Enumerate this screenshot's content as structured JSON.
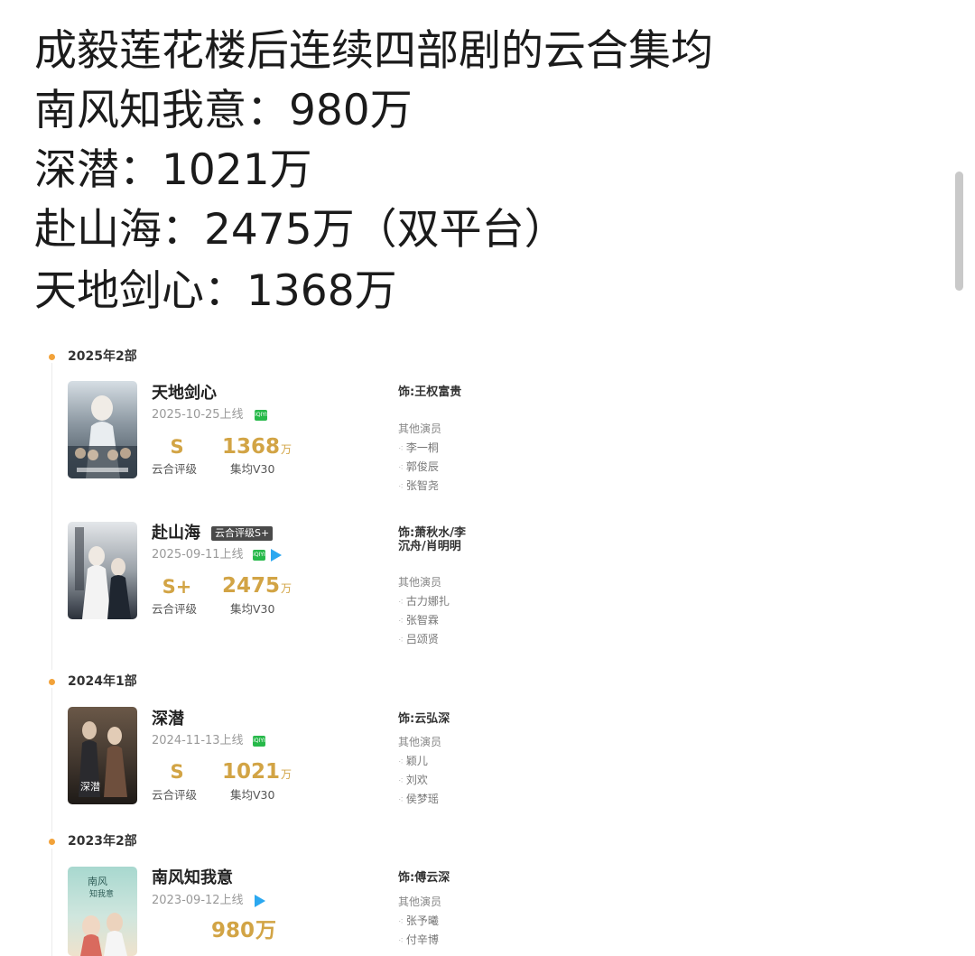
{
  "headline": {
    "line1": "成毅莲花楼后连续四部剧的云合集均",
    "line2": "南风知我意：980万",
    "line3": "深潜：1021万",
    "line4": "赴山海：2475万（双平台）",
    "line5": "天地剑心：1368万"
  },
  "timeline": {
    "years": [
      {
        "label": "2025年2部"
      },
      {
        "label": "2024年1部"
      },
      {
        "label": "2023年2部"
      }
    ],
    "shows": [
      {
        "title": "天地剑心",
        "date": "2025-10-25上线",
        "platforms": [
          "iqiyi-icon"
        ],
        "grade": "S",
        "grade_caption": "云合评级",
        "heat": "1368",
        "heat_unit": "万",
        "heat_caption": "集均V30",
        "role": "饰:王权富贵",
        "others_label": "其他演员",
        "cast": [
          "李一桐",
          "郭俊辰",
          "张智尧"
        ],
        "poster_colors": [
          "#c9d3da",
          "#52606c"
        ]
      },
      {
        "title": "赴山海",
        "badge": "云合评级S+",
        "date": "2025-09-11上线",
        "platforms": [
          "iqiyi-icon",
          "play-icon"
        ],
        "grade": "S+",
        "grade_caption": "云合评级",
        "heat": "2475",
        "heat_unit": "万",
        "heat_caption": "集均V30",
        "role": "饰:萧秋水/李沉舟/肖明明",
        "others_label": "其他演员",
        "cast": [
          "古力娜扎",
          "张智霖",
          "吕颂贤"
        ],
        "poster_colors": [
          "#d8dce0",
          "#2d3440"
        ]
      },
      {
        "title": "深潜",
        "date": "2024-11-13上线",
        "platforms": [
          "iqiyi-icon"
        ],
        "grade": "S",
        "grade_caption": "云合评级",
        "heat": "1021",
        "heat_unit": "万",
        "heat_caption": "集均V30",
        "role": "饰:云弘深",
        "others_label": "其他演员",
        "cast": [
          "颖儿",
          "刘欢",
          "侯梦瑶"
        ],
        "poster_colors": [
          "#5a4a3c",
          "#2b2420"
        ]
      },
      {
        "title": "南风知我意",
        "date": "2023-09-12上线",
        "platforms": [
          "play-icon"
        ],
        "heat": "980",
        "heat_unit": "万",
        "role": "饰:傅云深",
        "others_label": "其他演员",
        "cast": [
          "张予曦",
          "付辛博"
        ],
        "poster_colors": [
          "#9ed0c8",
          "#e8d9c0"
        ]
      }
    ]
  },
  "colors": {
    "accent_gold": "#d2a445",
    "timeline_dot": "#f2a23a",
    "iqiyi_green": "#27b94a",
    "video_blue": "#2ba8f0"
  }
}
